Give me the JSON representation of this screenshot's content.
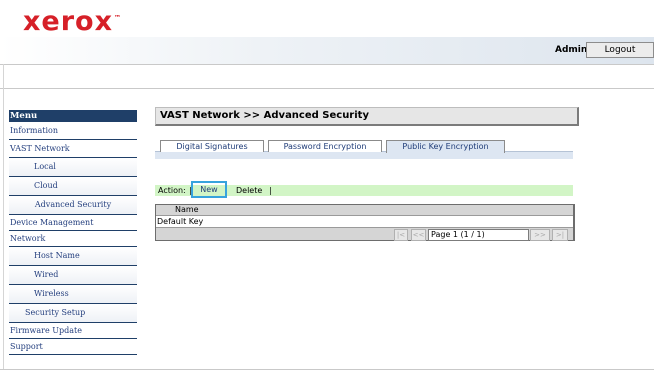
{
  "brand": {
    "logo_text": "xerox",
    "logo_mark": "™",
    "color": "#d62028"
  },
  "header": {
    "user": "Admin",
    "logout_label": "Logout"
  },
  "menu": {
    "title": "Menu",
    "items": [
      {
        "label": "Information",
        "level": 0
      },
      {
        "label": "VAST Network",
        "level": 0
      },
      {
        "label": "Local",
        "level": 1
      },
      {
        "label": "Cloud",
        "level": 1
      },
      {
        "label": "Advanced Security",
        "level": 1,
        "selected": true
      },
      {
        "label": "Device Management",
        "level": 0
      },
      {
        "label": "Network",
        "level": 0
      },
      {
        "label": "Host Name",
        "level": 1
      },
      {
        "label": "Wired",
        "level": 1
      },
      {
        "label": "Wireless",
        "level": 1
      },
      {
        "label": "Security Setup",
        "level": 1
      },
      {
        "label": "Firmware Update",
        "level": 0
      },
      {
        "label": "Support",
        "level": 0
      }
    ]
  },
  "page": {
    "title": "VAST Network >> Advanced Security"
  },
  "tabs": [
    {
      "label": "Digital Signatures"
    },
    {
      "label": "Password Encryption"
    },
    {
      "label": "Public Key Encryption",
      "active": true
    }
  ],
  "action_bar": {
    "label": "Action:",
    "separator": "|",
    "new_label": "New",
    "delete_label": "Delete"
  },
  "table": {
    "header": "Name",
    "rows": [
      "Default Key"
    ],
    "pager": {
      "first": "|<",
      "prev": "<<",
      "page_text": "Page 1 (1 / 1)",
      "next": ">>",
      "last": ">|"
    }
  },
  "colors": {
    "menu_header": "#1f3f68",
    "accent_highlight": "#37a3dd",
    "action_bar": "#d2f5c6"
  }
}
